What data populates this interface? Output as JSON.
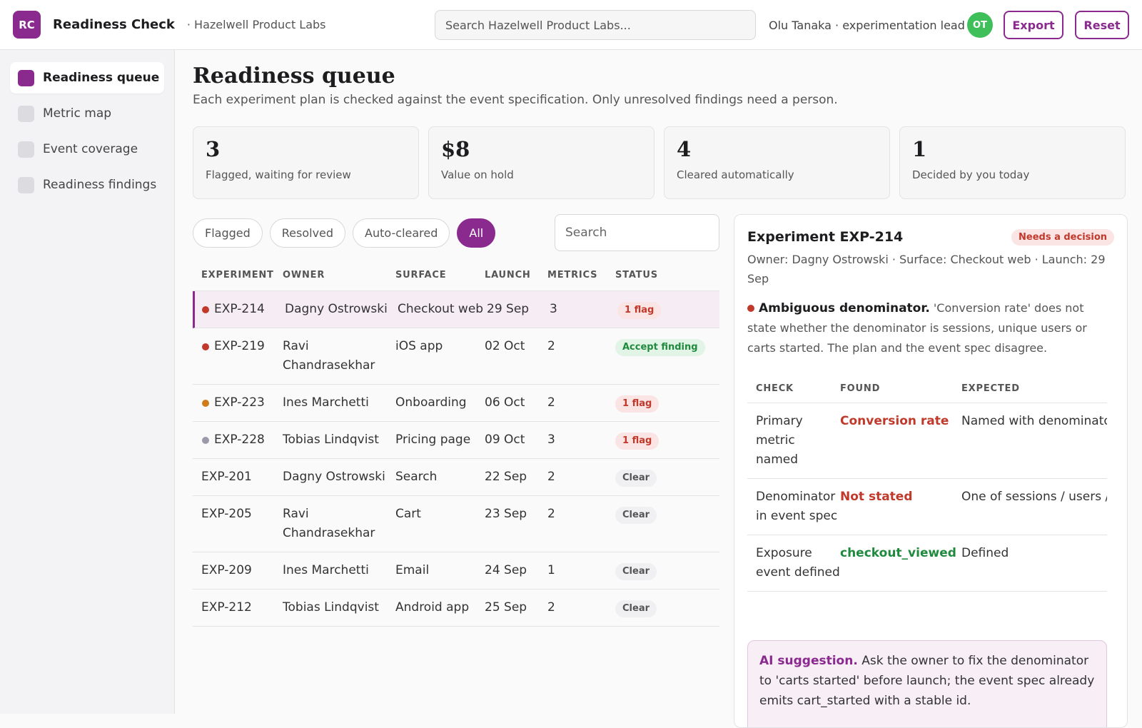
{
  "app": {
    "logo": "RC",
    "title": "Readiness Check",
    "org": "· Hazelwell Product Labs",
    "search_placeholder": "Search Hazelwell Product Labs...",
    "user": "Olu Tanaka · experimentation lead",
    "avatar": "OT",
    "export_label": "Export",
    "reset_label": "Reset",
    "accent_color": "#8a2a8f"
  },
  "sidebar": {
    "items": [
      {
        "label": "Readiness queue",
        "active": true
      },
      {
        "label": "Metric map",
        "active": false
      },
      {
        "label": "Event coverage",
        "active": false
      },
      {
        "label": "Readiness findings",
        "active": false
      }
    ]
  },
  "page": {
    "title": "Readiness queue",
    "subtitle": "Each experiment plan is checked against the event specification. Only unresolved findings need a person."
  },
  "stats": [
    {
      "value": "3",
      "label": "Flagged, waiting for review"
    },
    {
      "value": "$8",
      "label": "Value on hold"
    },
    {
      "value": "4",
      "label": "Cleared automatically"
    },
    {
      "value": "1",
      "label": "Decided by you today"
    }
  ],
  "filters": {
    "chips": [
      "Flagged",
      "Resolved",
      "Auto-cleared",
      "All"
    ],
    "active": "All",
    "search_placeholder": "Search"
  },
  "table": {
    "headers": [
      "EXPERIMENT",
      "OWNER",
      "SURFACE",
      "LAUNCH",
      "METRICS",
      "STATUS"
    ],
    "rows": [
      {
        "id": "EXP-214",
        "owner": "Dagny Ostrowski",
        "surface": "Checkout web",
        "launch": "29 Sep",
        "metrics": "3",
        "status": "1 flag",
        "status_kind": "flag",
        "dot": "#c0392b",
        "selected": true
      },
      {
        "id": "EXP-219",
        "owner": "Ravi Chandrasekhar",
        "surface": "iOS app",
        "launch": "02 Oct",
        "metrics": "2",
        "status": "Accept finding",
        "status_kind": "accept",
        "dot": "#c0392b",
        "selected": false
      },
      {
        "id": "EXP-223",
        "owner": "Ines Marchetti",
        "surface": "Onboarding",
        "launch": "06 Oct",
        "metrics": "2",
        "status": "1 flag",
        "status_kind": "flag",
        "dot": "#d07a1a",
        "selected": false
      },
      {
        "id": "EXP-228",
        "owner": "Tobias Lindqvist",
        "surface": "Pricing page",
        "launch": "09 Oct",
        "metrics": "3",
        "status": "1 flag",
        "status_kind": "flag",
        "dot": "#9a9aaa",
        "selected": false
      },
      {
        "id": "EXP-201",
        "owner": "Dagny Ostrowski",
        "surface": "Search",
        "launch": "22 Sep",
        "metrics": "2",
        "status": "Clear",
        "status_kind": "clear",
        "dot": "",
        "selected": false
      },
      {
        "id": "EXP-205",
        "owner": "Ravi Chandrasekhar",
        "surface": "Cart",
        "launch": "23 Sep",
        "metrics": "2",
        "status": "Clear",
        "status_kind": "clear",
        "dot": "",
        "selected": false
      },
      {
        "id": "EXP-209",
        "owner": "Ines Marchetti",
        "surface": "Email",
        "launch": "24 Sep",
        "metrics": "1",
        "status": "Clear",
        "status_kind": "clear",
        "dot": "",
        "selected": false
      },
      {
        "id": "EXP-212",
        "owner": "Tobias Lindqvist",
        "surface": "Android app",
        "launch": "25 Sep",
        "metrics": "2",
        "status": "Clear",
        "status_kind": "clear",
        "dot": "",
        "selected": false
      }
    ]
  },
  "detail": {
    "title": "Experiment EXP-214",
    "badge": "Needs a decision",
    "meta": "Owner: Dagny Ostrowski · Surface: Checkout web · Launch: 29 Sep",
    "finding_title": "Ambiguous denominator.",
    "finding_text": "'Conversion rate' does not state whether the denominator is sessions, unique users or carts started. The plan and the event spec disagree.",
    "check_headers": [
      "CHECK",
      "FOUND",
      "EXPECTED"
    ],
    "checks": [
      {
        "check": "Primary metric named",
        "found": "Conversion rate",
        "found_ok": false,
        "expected": "Named with denominator"
      },
      {
        "check": "Denominator in event spec",
        "found": "Not stated",
        "found_ok": false,
        "expected": "One of sessions / users / carts"
      },
      {
        "check": "Exposure event defined",
        "found": "checkout_viewed",
        "found_ok": true,
        "expected": "Defined"
      }
    ],
    "ai_label": "AI suggestion.",
    "ai_text": "Ask the owner to fix the denominator to 'carts started' before launch; the event spec already emits cart_started with a stable id."
  }
}
